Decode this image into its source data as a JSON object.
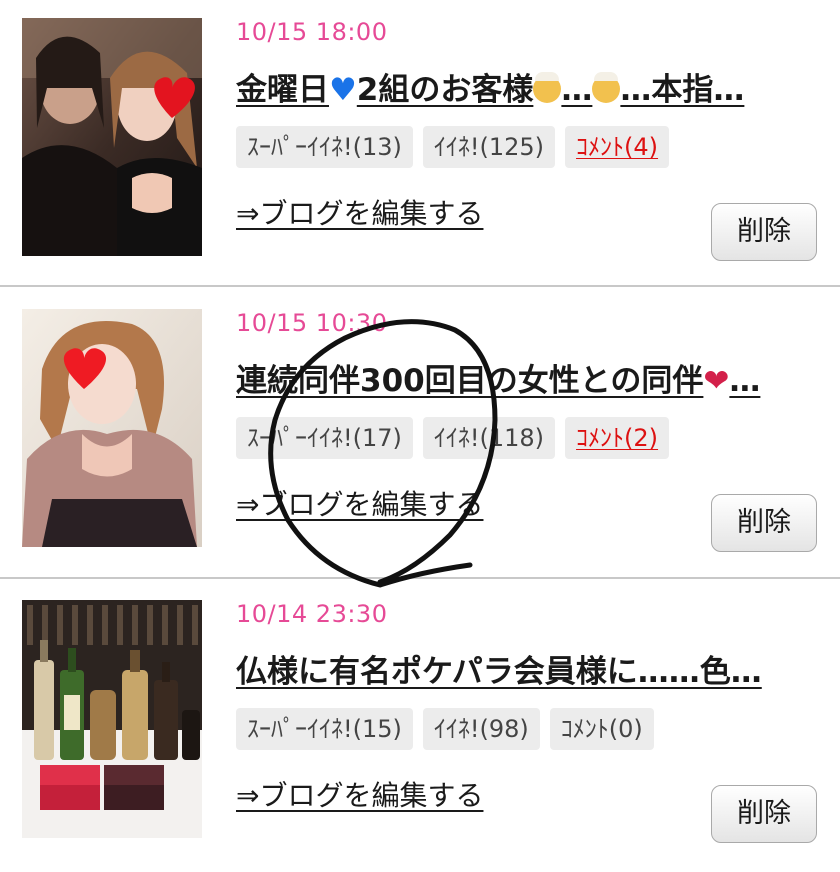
{
  "posts": [
    {
      "date": "10/15 18:00",
      "title_part1": "金曜日",
      "title_emoji1": "blue-heart",
      "title_part2": "2組のお客様",
      "title_emoji2": "older-man-face",
      "title_part3": "…",
      "title_emoji3": "older-man-face",
      "title_part4": "…本指…",
      "super_like": "ｽｰﾊﾟｰｲｲﾈ!(13)",
      "like": "ｲｲﾈ!(125)",
      "comment": "ｺﾒﾝﾄ(4)",
      "comment_active": true,
      "edit_link": "⇒ブログを編集する",
      "delete_label": "削除"
    },
    {
      "date": "10/15 10:30",
      "title_part1": "連続同伴300回目の女性との同伴",
      "title_emoji1": "kiss-mark",
      "title_part2": "…",
      "super_like": "ｽｰﾊﾟｰｲｲﾈ!(17)",
      "like": "ｲｲﾈ!(118)",
      "comment": "ｺﾒﾝﾄ(2)",
      "comment_active": true,
      "edit_link": "⇒ブログを編集する",
      "delete_label": "削除"
    },
    {
      "date": "10/14 23:30",
      "title_part1": "仏様に有名ポケパラ会員様に……色…",
      "super_like": "ｽｰﾊﾟｰｲｲﾈ!(15)",
      "like": "ｲｲﾈ!(98)",
      "comment": "ｺﾒﾝﾄ(0)",
      "comment_active": false,
      "edit_link": "⇒ブログを編集する",
      "delete_label": "削除"
    }
  ],
  "colors": {
    "date": "#e64a96",
    "comment_active": "#dd1111",
    "badge_bg": "#ececec",
    "divider": "#c8c8c8",
    "annotation_stroke": "#111111"
  }
}
